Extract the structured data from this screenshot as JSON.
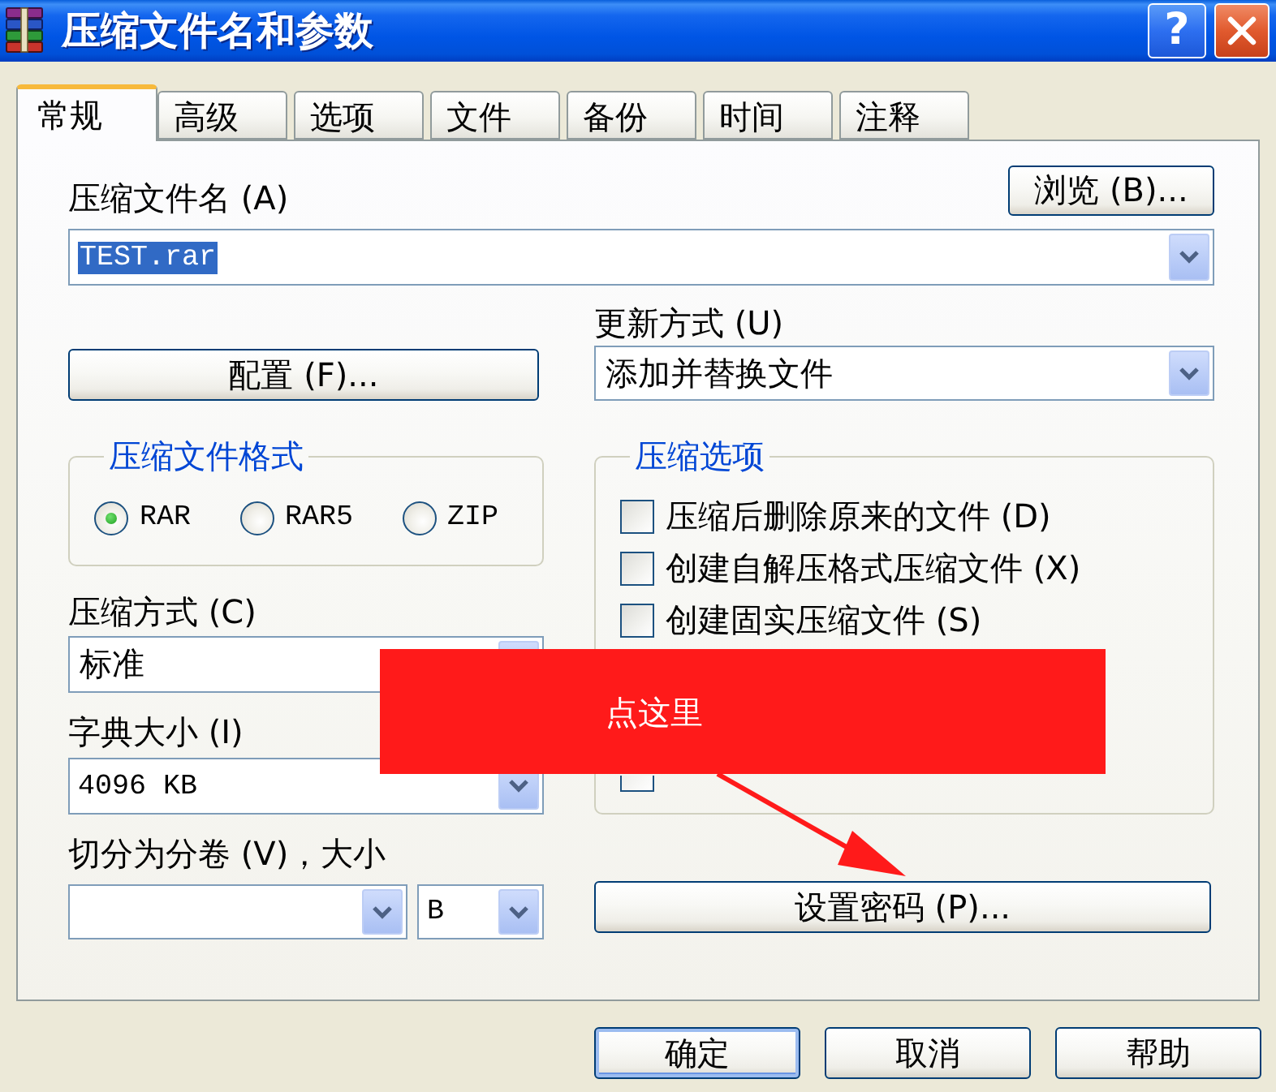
{
  "window": {
    "title": "压缩文件名和参数",
    "help_button": "?"
  },
  "tabs": [
    {
      "label": "常规",
      "selected": true
    },
    {
      "label": "高级",
      "selected": false
    },
    {
      "label": "选项",
      "selected": false
    },
    {
      "label": "文件",
      "selected": false
    },
    {
      "label": "备份",
      "selected": false
    },
    {
      "label": "时间",
      "selected": false
    },
    {
      "label": "注释",
      "selected": false
    }
  ],
  "archive_name": {
    "label": "压缩文件名 (A)",
    "value": "TEST.rar",
    "value_selected": true,
    "browse_button": "浏览 (B)..."
  },
  "profiles_button": "配置 (F)...",
  "update_mode": {
    "label": "更新方式 (U)",
    "value": "添加并替换文件"
  },
  "archive_format": {
    "title": "压缩文件格式",
    "options": [
      {
        "label": "RAR",
        "selected": true
      },
      {
        "label": "RAR5",
        "selected": false
      },
      {
        "label": "ZIP",
        "selected": false
      }
    ]
  },
  "archiving_options": {
    "title": "压缩选项",
    "options": [
      {
        "label": "压缩后删除原来的文件 (D)",
        "checked": false
      },
      {
        "label": "创建自解压格式压缩文件 (X)",
        "checked": false
      },
      {
        "label": "创建固实压缩文件 (S)",
        "checked": false
      },
      {
        "checked": false
      }
    ]
  },
  "compression_method": {
    "label": "压缩方式 (C)",
    "value": "标准"
  },
  "dictionary_size": {
    "label": "字典大小 (I)",
    "value": "4096 KB"
  },
  "split_volumes": {
    "label": "切分为分卷 (V)，大小",
    "unit": "B"
  },
  "set_password_button": "设置密码 (P)...",
  "dialog_buttons": [
    {
      "label": "确定",
      "default": true
    },
    {
      "label": "取消",
      "default": false
    },
    {
      "label": "帮助",
      "default": false
    }
  ],
  "annotation": {
    "text": "点这里"
  }
}
